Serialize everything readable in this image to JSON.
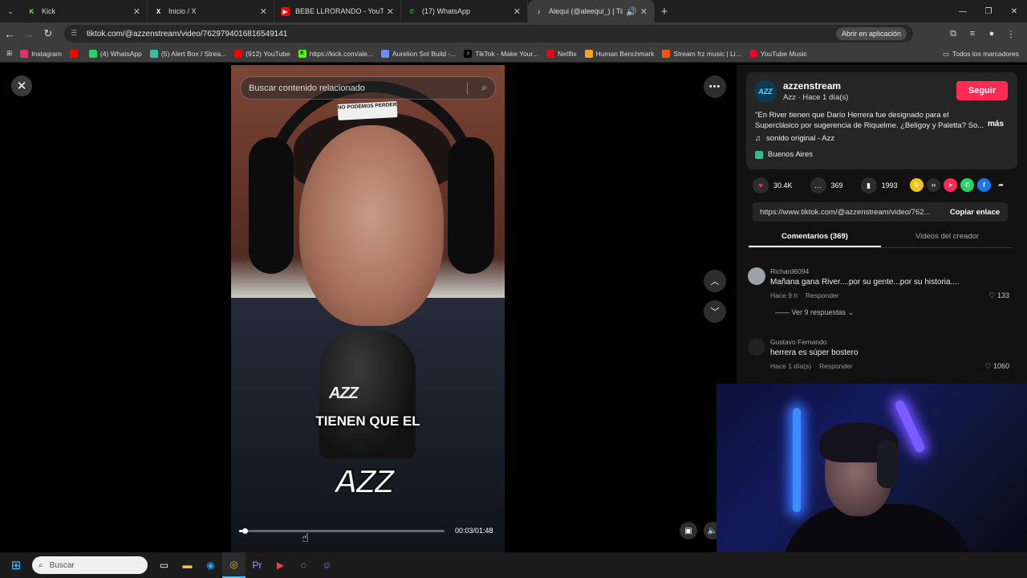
{
  "browser": {
    "tabs": [
      {
        "label": "Kick",
        "fav": "K",
        "color": "#53fc18",
        "active": false
      },
      {
        "label": "Inicio / X",
        "fav": "X",
        "color": "#000000",
        "active": false
      },
      {
        "label": "BEBE LLRORANDO - YouTube",
        "fav": "▶",
        "color": "#ff0000",
        "active": false
      },
      {
        "label": "(17) WhatsApp",
        "fav": "✆",
        "color": "#25d366",
        "active": false
      },
      {
        "label": "Alequi (@aleequi_) | TikTok",
        "fav": "♪",
        "color": "#000000",
        "active": true
      }
    ],
    "url": "tiktok.com/@azzenstream/video/7629794016816549141",
    "open_app_label": "Abrir en aplicación",
    "bookmarks": [
      {
        "label": "Instagram",
        "color": "#e1306c",
        "icon": "instagram-icon"
      },
      {
        "label": "",
        "color": "#ff0000",
        "icon": "youtube-icon"
      },
      {
        "label": "(4) WhatsApp",
        "color": "#25d366",
        "icon": "whatsapp-icon"
      },
      {
        "label": "(5) Alert Box / Strea...",
        "color": "#31c3a2",
        "icon": "streamlabs-icon"
      },
      {
        "label": "(912) YouTube",
        "color": "#ff0000",
        "icon": "youtube-icon"
      },
      {
        "label": "https://kick.com/ale...",
        "color": "#53fc18",
        "icon": "kick-icon"
      },
      {
        "label": "Aurelion Sol Build -...",
        "color": "#6b8cff",
        "icon": "build-icon"
      },
      {
        "label": "TikTok - Make Your...",
        "color": "#000000",
        "icon": "tiktok-icon"
      },
      {
        "label": "Netflix",
        "color": "#e50914",
        "icon": "netflix-icon"
      },
      {
        "label": "Human Benchmark",
        "color": "#f5a623",
        "icon": "benchmark-icon"
      },
      {
        "label": "Stream frz music | Li...",
        "color": "#ff5500",
        "icon": "soundcloud-icon"
      },
      {
        "label": "YouTube Music",
        "color": "#ff0033",
        "icon": "youtube-music-icon"
      }
    ],
    "all_bookmarks_label": "Todos los marcadores"
  },
  "video": {
    "search_placeholder": "Buscar contenido relacionado",
    "sticker_text": "NO PODEMOS PERDER",
    "caption": "TIENEN QUE EL",
    "watermark": "AZZ",
    "mic_logo": "AZZ",
    "time": "00:03/01:48",
    "progress_fraction": 0.028
  },
  "creator": {
    "avatar_text": "AZZ",
    "username": "azzenstream",
    "subline": "Azz · Hace 1 día(s)",
    "follow_label": "Seguir",
    "description": "\"En River tienen que Darío Herrera fue designado para el Superclásico por sugerencia de Riquelme. ¿Beligoy y Paletta? So...",
    "more_label": "más",
    "music": "sonido original - Azz",
    "location": "Buenos Aires"
  },
  "stats": {
    "likes": "30.4K",
    "comments": "369",
    "saves": "1993"
  },
  "share": {
    "link": "https://www.tiktok.com/@azzenstream/video/762...",
    "copy_label": "Copiar enlace"
  },
  "panel_tabs": {
    "comments": "Comentarios (369)",
    "creator_videos": "Videos del creador"
  },
  "comments": [
    {
      "user": "Richard6094",
      "text": "Mañana gana River....por su gente...por su historia....",
      "time": "Hace 9 h",
      "reply": "Responder",
      "likes": "133",
      "replies": "Ver 9 respuestas"
    },
    {
      "user": "Gustavo Fernando",
      "text": "herrera es súper bostero",
      "time": "Hace 1 día(s)",
      "reply": "Responder",
      "likes": "1060",
      "replies": ""
    }
  ],
  "taskbar": {
    "search_placeholder": "Buscar"
  }
}
